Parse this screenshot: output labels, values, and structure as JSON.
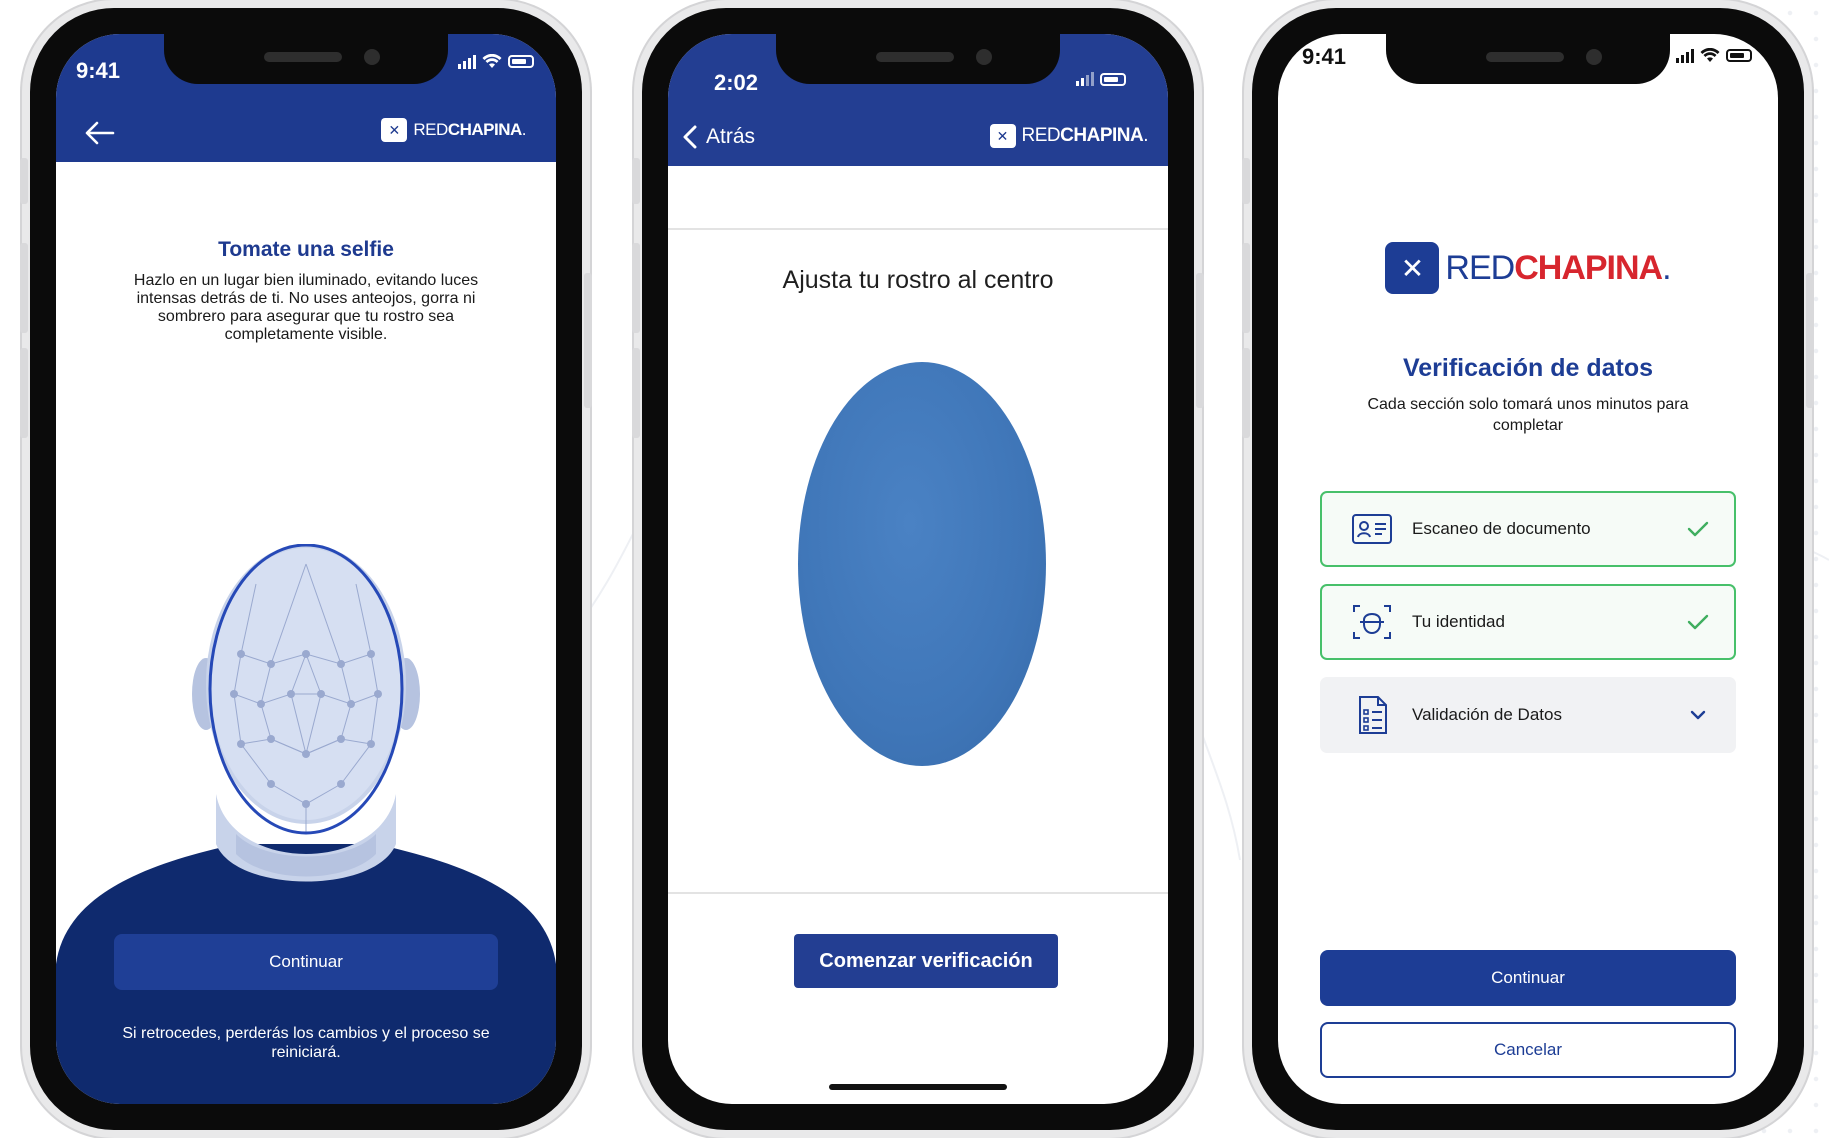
{
  "phones": [
    {
      "status_time": "9:41",
      "header": {
        "brand_light": "RED",
        "brand_bold": "CHAPINA",
        "brand_dot": "."
      },
      "title": "Tomate una selfie",
      "description": "Hazlo en un lugar bien iluminado, evitando luces intensas detrás de ti. No uses anteojos, gorra ni sombrero para asegurar que tu rostro sea completamente visible.",
      "button": "Continuar",
      "footnote": "Si retrocedes, perderás los cambios y el proceso se reiniciará.",
      "icons": {
        "back": "arrow-left-icon",
        "logo": "redchapina-logo-icon"
      },
      "colors": {
        "header_bg": "#1e3a8f",
        "shirt": "#0f2a6e"
      }
    },
    {
      "status_time": "2:02",
      "header": {
        "back_label": "Atrás",
        "brand_light": "RED",
        "brand_bold": "CHAPINA",
        "brand_dot": "."
      },
      "instruction": "Ajusta tu rostro al centro",
      "button": "Comenzar verificación",
      "icons": {
        "back": "chevron-left-icon"
      },
      "colors": {
        "header_bg": "#233e92",
        "oval": "#4078bb"
      }
    },
    {
      "status_time": "9:41",
      "logo": {
        "light": "RED",
        "bold": "CHAPINA",
        "dot": "."
      },
      "title": "Verificación de datos",
      "subtitle": "Cada sección solo tomará unos minutos para completar",
      "sections": [
        {
          "label": "Escaneo de documento",
          "status": "complete",
          "icon": "id-card-icon",
          "trail": "checkmark-icon"
        },
        {
          "label": "Tu identidad",
          "status": "complete",
          "icon": "face-scan-icon",
          "trail": "checkmark-icon"
        },
        {
          "label": "Validación de Datos",
          "status": "pending",
          "icon": "document-list-icon",
          "trail": "chevron-down-icon"
        }
      ],
      "primary_button": "Continuar",
      "secondary_button": "Cancelar",
      "colors": {
        "brand_blue": "#1d3d95",
        "brand_red": "#d7262e",
        "success_green": "#47c06a"
      }
    }
  ]
}
